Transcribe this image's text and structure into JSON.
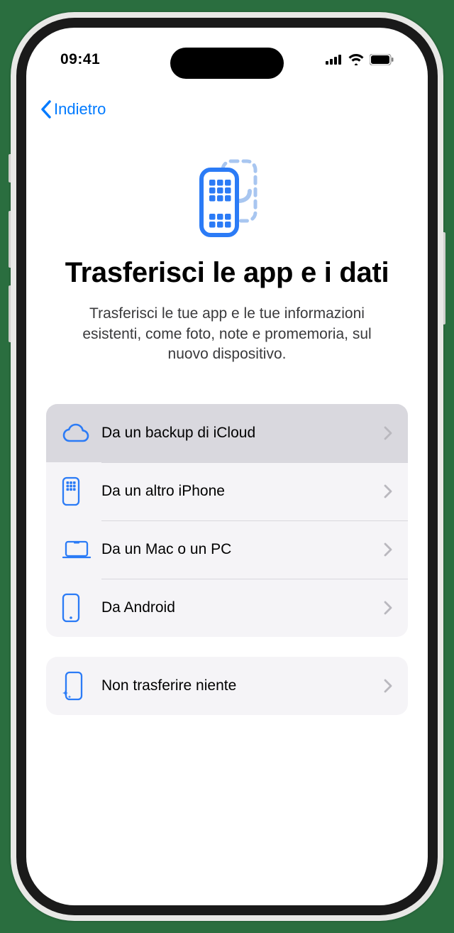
{
  "status": {
    "time": "09:41"
  },
  "nav": {
    "back_label": "Indietro"
  },
  "page": {
    "title": "Trasferisci le app e i dati",
    "subtitle": "Trasferisci le tue app e le tue informazioni esistenti, come foto, note e promemoria, sul nuovo dispositivo."
  },
  "options": {
    "icloud": "Da un backup di iCloud",
    "iphone": "Da un altro iPhone",
    "macpc": "Da un Mac o un PC",
    "android": "Da Android",
    "nothing": "Non trasferire niente"
  },
  "colors": {
    "accent": "#007aff",
    "icon_blue": "#2b7bf6"
  }
}
